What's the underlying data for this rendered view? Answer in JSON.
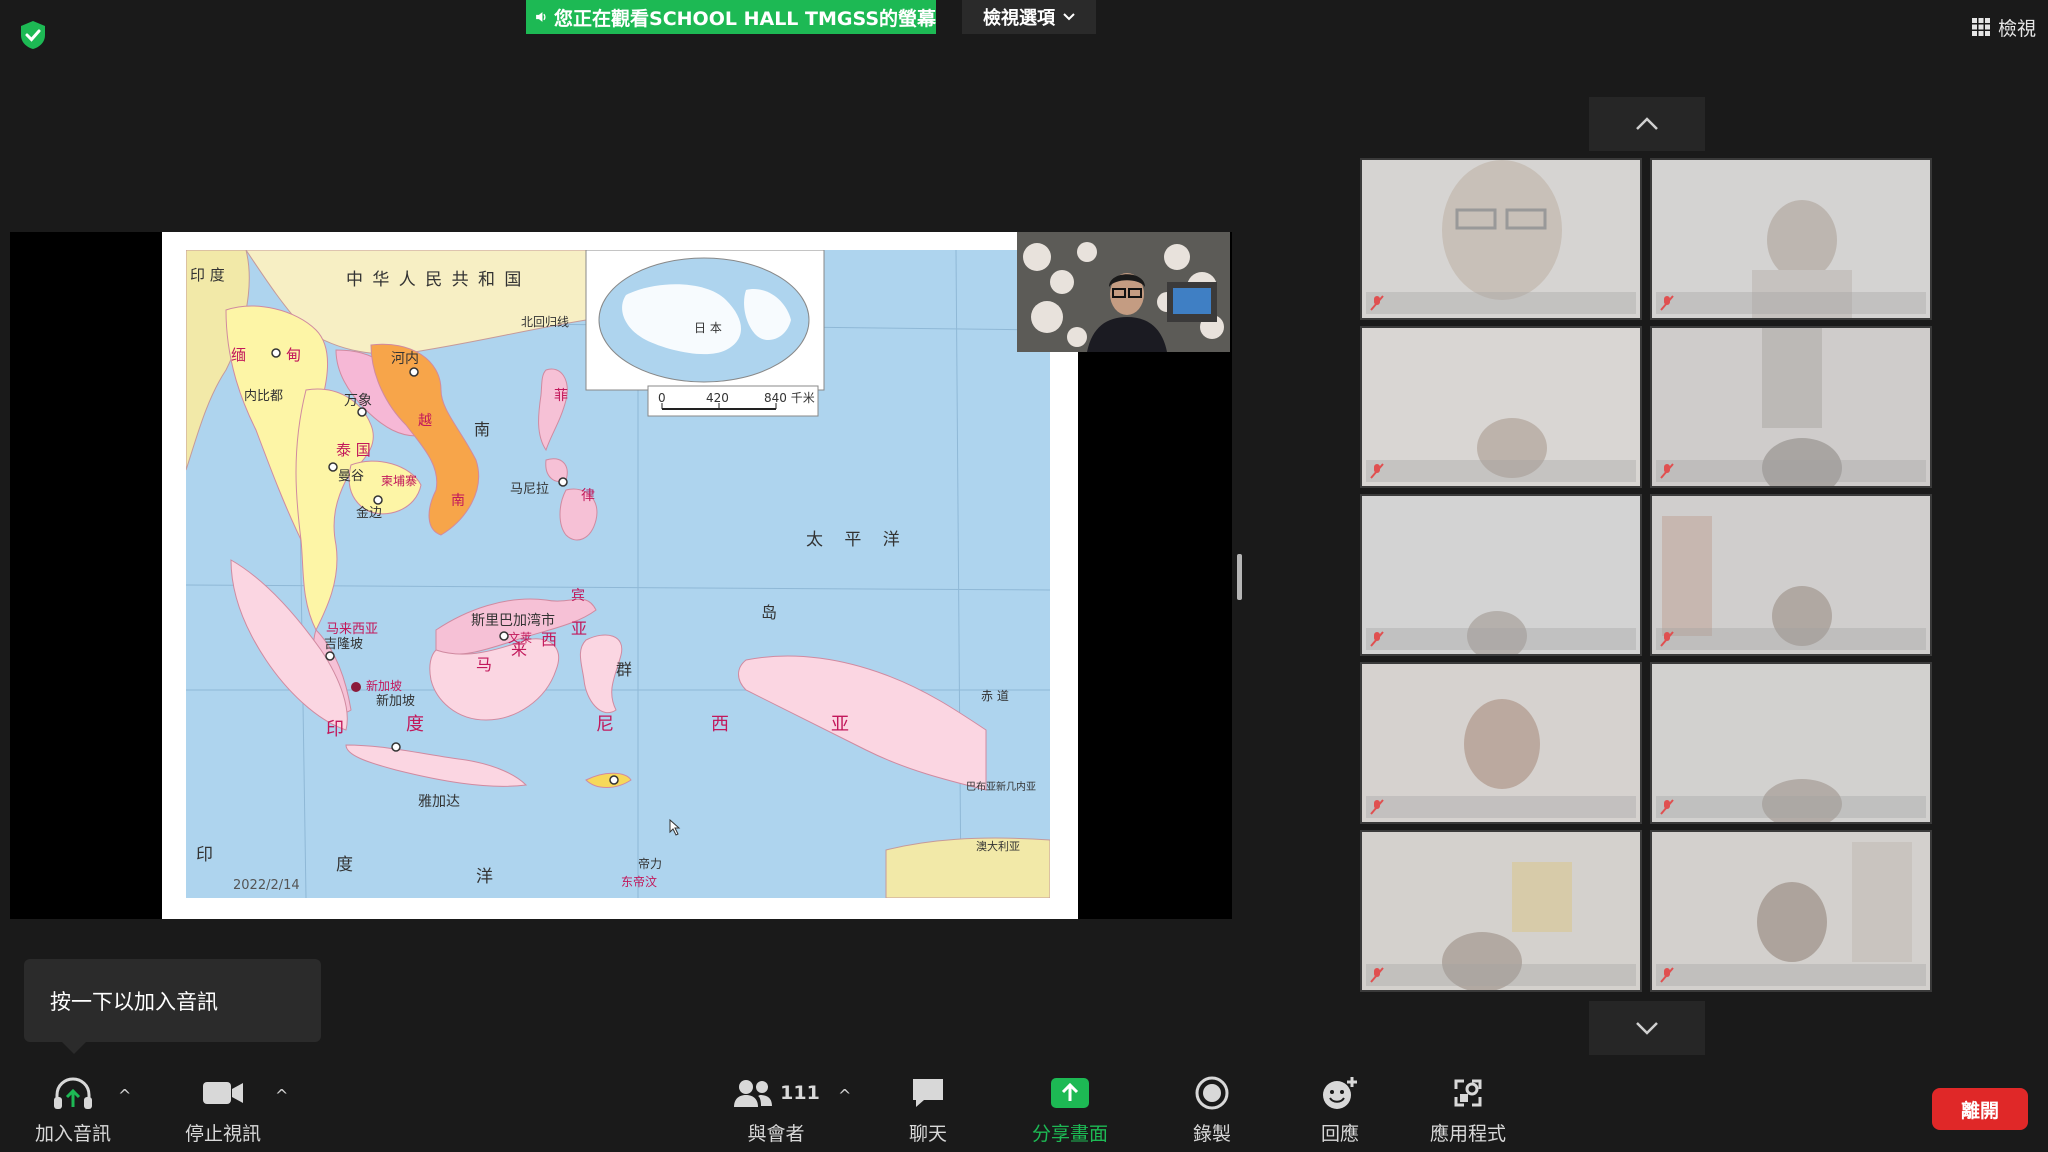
{
  "banner": {
    "text": "您正在觀看SCHOOL HALL TMGSS的螢幕"
  },
  "view_options": {
    "label": "檢視選項"
  },
  "view_button": {
    "label": "檢視"
  },
  "slide": {
    "date": "2022/2/14"
  },
  "map": {
    "country_title": "中 华 人 民 共 和 国",
    "tropic_label": "北回归线",
    "scale_labels": [
      "0",
      "420",
      "840 千米"
    ],
    "labels": {
      "india": "印 度",
      "myanmar_a": "缅",
      "myanmar_b": "甸",
      "naypyidaw": "内比都",
      "hanoi": "河内",
      "vientiane": "万象",
      "viet": "越",
      "nan": "南",
      "thailand": "泰 国",
      "bangkok": "曼谷",
      "phnom_penh": "金边",
      "cambodia": "柬埔寨",
      "manila": "马尼拉",
      "philippines_a": "菲",
      "philippines_b": "律",
      "philippines_c": "宾",
      "pacific": "太 平 洋",
      "south_sea": "南",
      "brunei_city": "斯里巴加湾市",
      "brunei": "文莱",
      "malaysia_label": "马来西亚",
      "kuala_lumpur": "吉隆坡",
      "singapore_label": "新加坡",
      "singapore_city": "新加坡",
      "malay_a": "马",
      "malay_b": "来",
      "malay_c": "西",
      "malay_d": "亚",
      "indonesia_a": "印",
      "indonesia_b": "度",
      "indonesia_c": "尼",
      "indonesia_d": "西",
      "indonesia_e": "亚",
      "jakarta": "雅加达",
      "indian_ocean_a": "印",
      "indian_ocean_b": "度",
      "indian_ocean_c": "洋",
      "islands": "群",
      "island2": "岛",
      "equator": "赤 道",
      "png": "巴布亚新几内亚",
      "australia": "澳大利亚",
      "dili": "帝力",
      "timor": "东帝汶",
      "japan": "日 本"
    }
  },
  "audio_tooltip": {
    "text": "按一下以加入音訊"
  },
  "toolbar": {
    "join_audio": "加入音訊",
    "stop_video": "停止視訊",
    "participants": "與會者",
    "participant_count": "111",
    "chat": "聊天",
    "share_screen": "分享畫面",
    "record": "錄製",
    "reactions": "回應",
    "apps": "應用程式",
    "leave": "離開"
  },
  "colors": {
    "banner_green": "#1db954",
    "leave_red": "#e02828",
    "sea_blue": "#aed4ee"
  }
}
